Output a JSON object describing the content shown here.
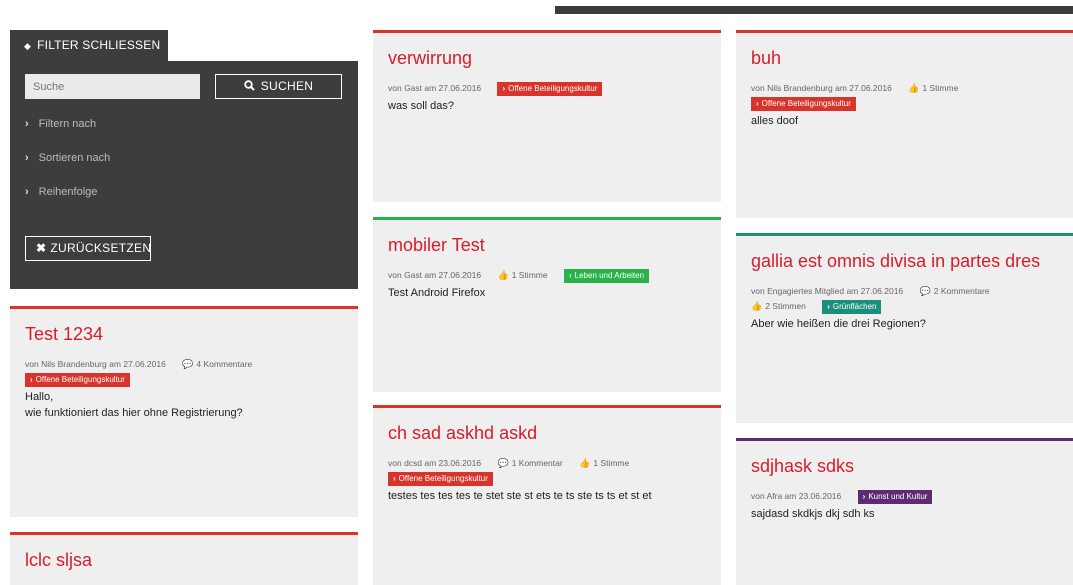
{
  "filter": {
    "tab_label": "FILTER SCHLIESSEN",
    "search_placeholder": "Suche",
    "search_button": "SUCHEN",
    "rows": [
      "Filtern nach",
      "Sortieren nach",
      "Reihenfolge"
    ],
    "reset_button": "ZURÜCKSETZEN"
  },
  "cards": [
    {
      "title": "Test 1234",
      "author_line": "von Nils Brandenburg am 27.06.2016",
      "comments": "4 Kommentare",
      "votes": "",
      "category": "Offene Beteiligungskultur",
      "category_color": "#d9342b",
      "body": [
        "Hallo,",
        "wie funktioniert das hier ohne Registrierung?"
      ]
    },
    {
      "title": "lclc sljsa",
      "author_line": "",
      "comments": "",
      "votes": "",
      "category": "",
      "body": []
    },
    {
      "title": "verwirrung",
      "author_line": "von Gast am 27.06.2016",
      "comments": "",
      "votes": "",
      "category": "Offene Beteiligungskultur",
      "category_color": "#d9342b",
      "body": [
        "was soll das?"
      ]
    },
    {
      "title": "mobiler Test",
      "author_line": "von Gast am 27.06.2016",
      "comments": "",
      "votes": "1 Stimme",
      "category": "Leben und Arbeiten",
      "category_color": "#28b34b",
      "body": [
        "Test Android Firefox"
      ]
    },
    {
      "title": "ch sad askhd askd",
      "author_line": "von dcsd am 23.06.2016",
      "comments": "1 Kommentar",
      "votes": "1 Stimme",
      "category": "Offene Beteiligungskultur",
      "category_color": "#d9342b",
      "body": [
        "testes tes tes tes te stet ste st ets te ts ste ts ts et st et"
      ]
    },
    {
      "title": "buh",
      "author_line": "von Nils Brandenburg am 27.06.2016",
      "comments": "",
      "votes": "1 Stimme",
      "category": "Offene Beteiligungskultur",
      "category_color": "#d9342b",
      "body": [
        "alles doof"
      ]
    },
    {
      "title": "gallia est omnis divisa in partes dres",
      "author_line": "von Engagiertes Mitglied am 27.06.2016",
      "comments": "2 Kommentare",
      "votes": "2 Stimmen",
      "category": "Grünflächen",
      "category_color": "#1a8f7a",
      "body": [
        "Aber wie heißen die drei Regionen?"
      ]
    },
    {
      "title": "sdjhask sdks",
      "author_line": "von Afra am 23.06.2016",
      "comments": "",
      "votes": "",
      "category": "Kunst und Kultur",
      "category_color": "#5c2c72",
      "body": [
        "sajdasd skdkjs dkj sdh ks"
      ]
    }
  ],
  "icons": {
    "caret": "caret-updown-icon",
    "search": "search-icon",
    "chevron": "chevron-right-icon",
    "reset": "close-icon",
    "comment": "comment-icon",
    "vote": "thumbs-up-icon"
  }
}
